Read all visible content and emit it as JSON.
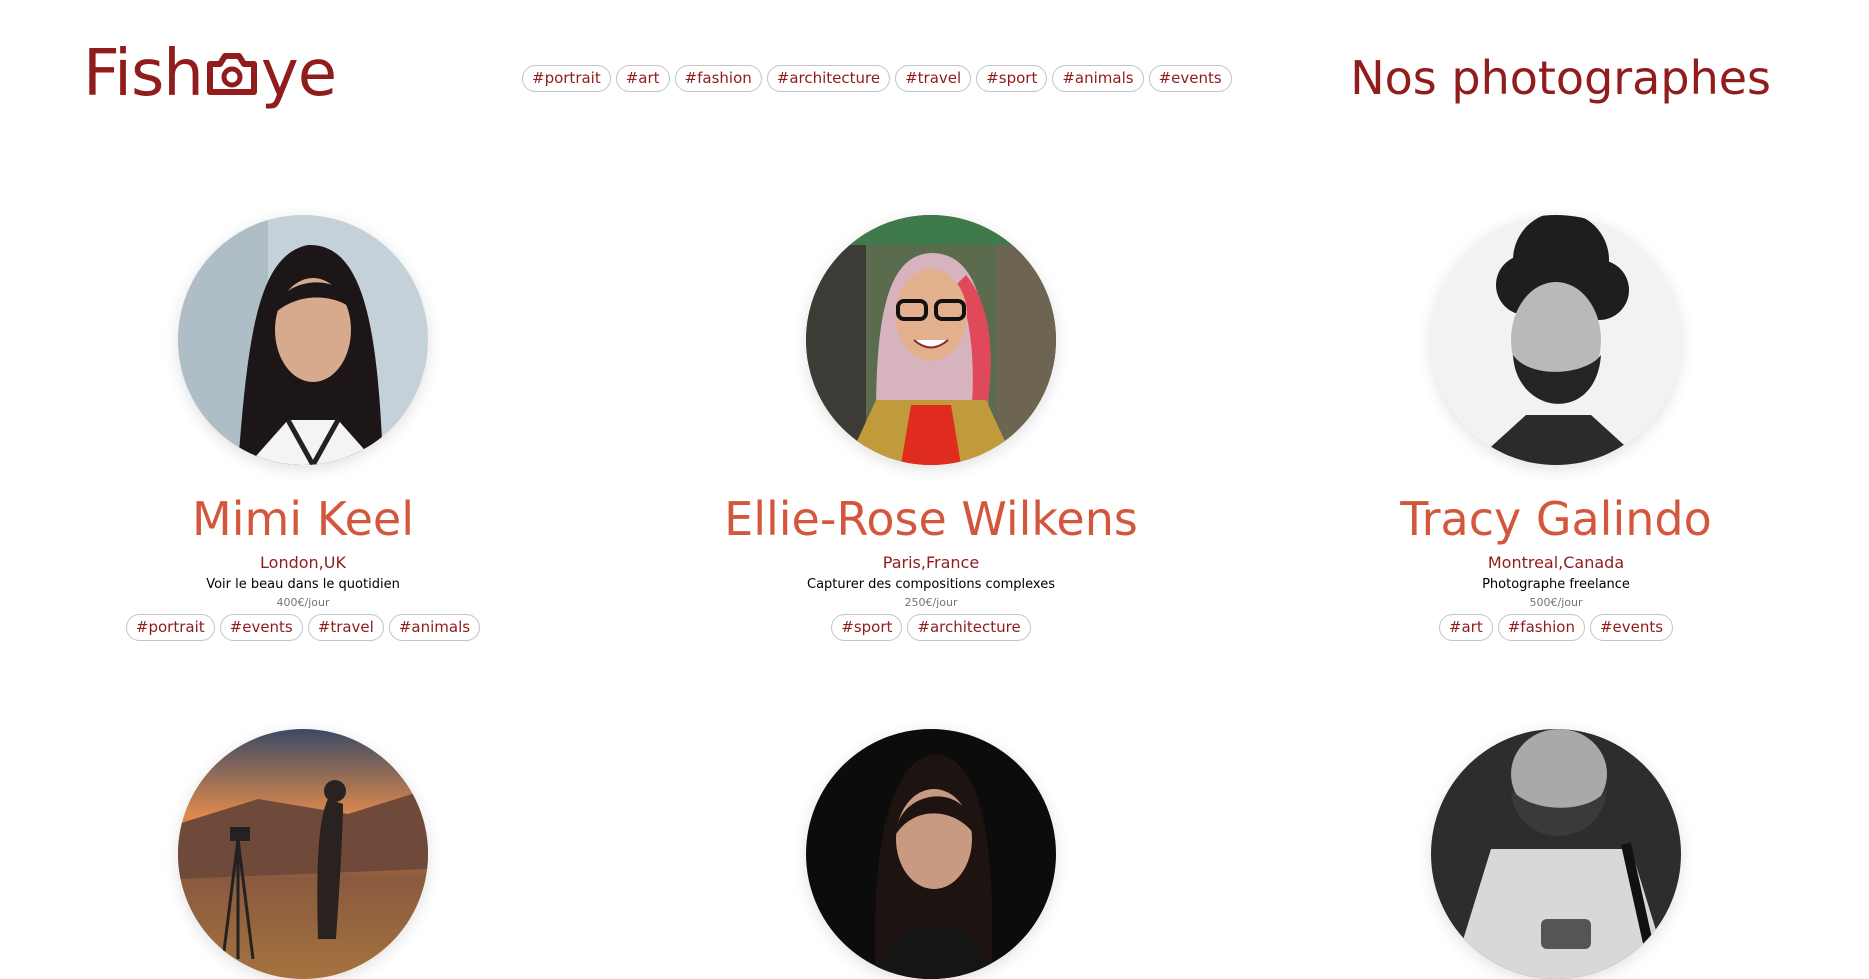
{
  "header": {
    "logo_prefix": "Fish",
    "logo_suffix": "ye",
    "title": "Nos photographes",
    "nav_tags": [
      "#portrait",
      "#art",
      "#fashion",
      "#architecture",
      "#travel",
      "#sport",
      "#animals",
      "#events"
    ]
  },
  "colors": {
    "brand": "#901c1c",
    "name": "#d3573c",
    "tag_border": "#c4c4c4"
  },
  "photographers": [
    {
      "name": "Mimi Keel",
      "location": "London,UK",
      "tagline": "Voir le beau dans le quotidien",
      "price": "400€/jour",
      "tags": [
        "#portrait",
        "#events",
        "#travel",
        "#animals"
      ]
    },
    {
      "name": "Ellie-Rose Wilkens",
      "location": "Paris,France",
      "tagline": "Capturer des compositions complexes",
      "price": "250€/jour",
      "tags": [
        "#sport",
        "#architecture"
      ]
    },
    {
      "name": "Tracy Galindo",
      "location": "Montreal,Canada",
      "tagline": "Photographe freelance",
      "price": "500€/jour",
      "tags": [
        "#art",
        "#fashion",
        "#events"
      ]
    }
  ]
}
